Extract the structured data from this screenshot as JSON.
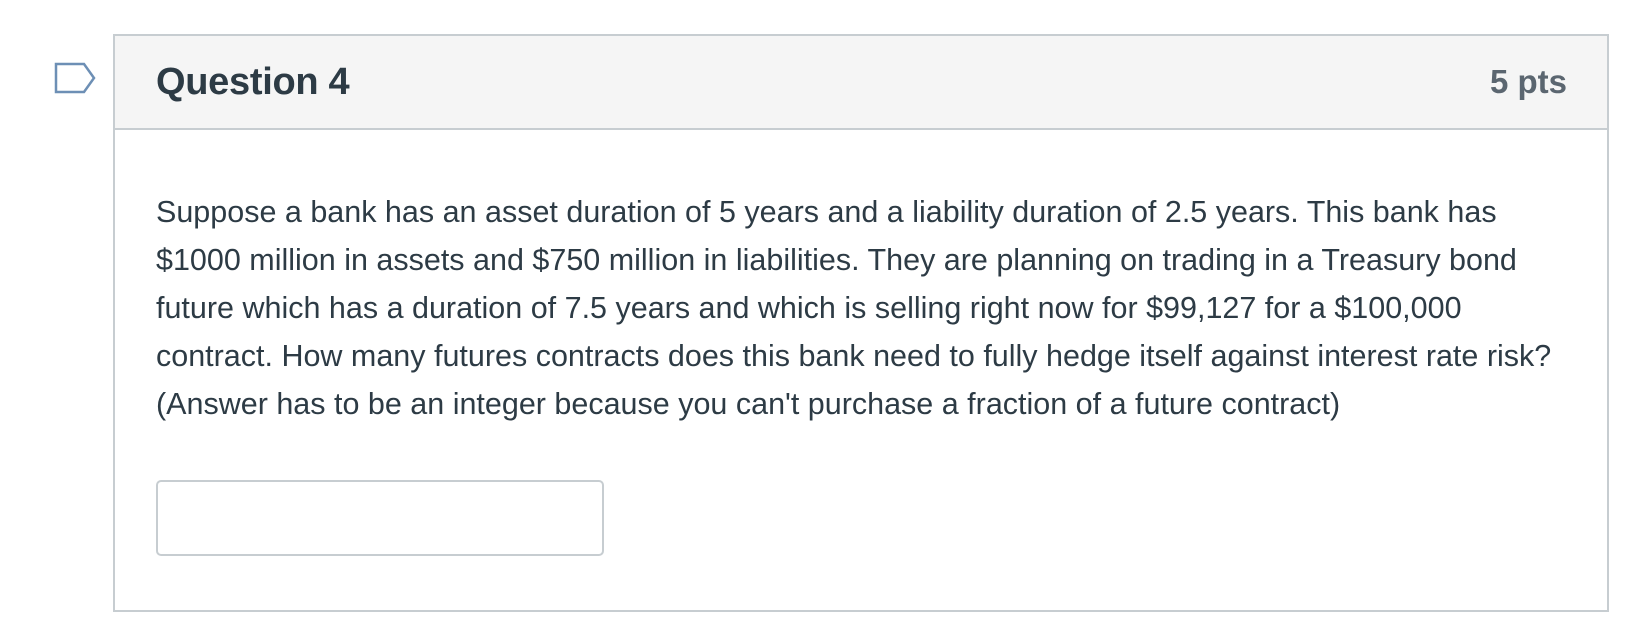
{
  "question": {
    "title": "Question 4",
    "points": "5 pts",
    "text": "Suppose a bank has an asset duration of 5 years and a liability duration of 2.5 years. This bank has $1000 million in assets and $750 million in liabilities. They are planning on trading in a Treasury bond future which has a duration of 7.5 years and which is selling right now for $99,127 for a $100,000 contract. How many futures contracts does this bank need to fully hedge itself against interest rate risk? (Answer has to be an integer because you can't purchase a fraction of a future contract)",
    "answer_value": "",
    "flag_icon": "flag-question-icon"
  },
  "colors": {
    "border": "#c7cdd1",
    "header_bg": "#f5f5f5",
    "text": "#2d3b45",
    "flag": "#6d8fb5"
  }
}
